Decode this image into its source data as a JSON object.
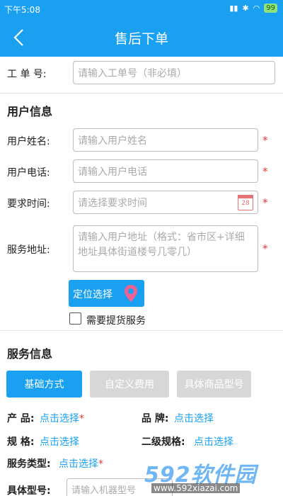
{
  "status_bar": {
    "time": "下午5:08",
    "battery": "99"
  },
  "nav": {
    "title": "售后下单"
  },
  "order": {
    "label": "工 单 号:",
    "placeholder": "请输入工单号（非必填）"
  },
  "user_section": {
    "title": "用户信息",
    "name_label": "用户姓名:",
    "name_placeholder": "请输入用户姓名",
    "phone_label": "用户电话:",
    "phone_placeholder": "请输入用户电话",
    "time_label": "要求时间:",
    "time_placeholder": "请选择要求时间",
    "calendar_day": "28",
    "address_label": "服务地址:",
    "address_placeholder": "请输入用户地址（格式：省市区+详细地址具体街道楼号几零几）",
    "required_mark": "*",
    "locate_button": "定位选择",
    "pickup_label": "需要提货服务"
  },
  "service_section": {
    "title": "服务信息",
    "tabs": [
      {
        "label": "基础方式",
        "active": true
      },
      {
        "label": "自定义费用",
        "active": false
      },
      {
        "label": "具体商品型号",
        "active": false
      }
    ],
    "product_label": "产 品:",
    "product_value": "点击选择",
    "brand_label": "品 牌:",
    "brand_value": "点击选择",
    "spec_label": "规 格:",
    "spec_value": "点击选择",
    "spec2_label": "二级规格:",
    "spec2_value": "点击选择",
    "type_label": "服务类型:",
    "type_value": "点击选择",
    "model_label": "具体型号:",
    "model_placeholder": "请输入机器型号"
  },
  "watermark": {
    "brand": "592软件园",
    "url": "www.592xiazai.com"
  },
  "colors": {
    "primary": "#1aa0f0",
    "required": "#e53935",
    "tab_inactive": "#d7d7d7"
  }
}
